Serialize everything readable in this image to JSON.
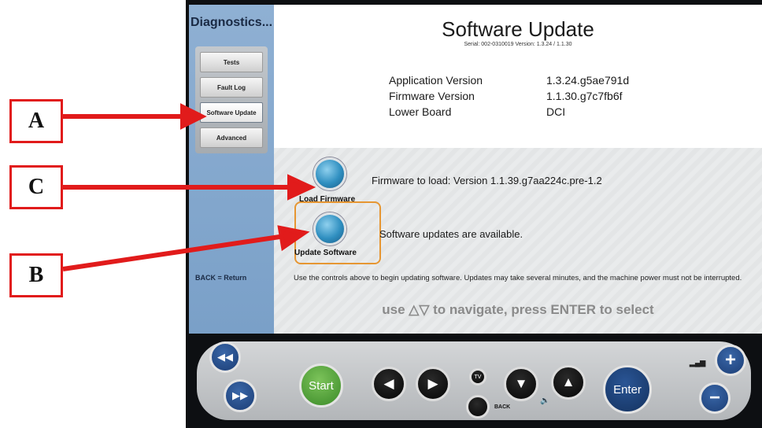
{
  "sidebar": {
    "title": "Diagnostics...",
    "items": [
      {
        "label": "Tests"
      },
      {
        "label": "Fault Log"
      },
      {
        "label": "Software Update"
      },
      {
        "label": "Advanced"
      }
    ],
    "back_hint": "BACK = Return"
  },
  "header": {
    "title": "Software Update",
    "serial_line": "Serial: 002-0310019  Version: 1.3.24 / 1.1.30"
  },
  "info": [
    {
      "label": "Application Version",
      "value": "1.3.24.g5ae791d"
    },
    {
      "label": "Firmware Version",
      "value": "1.1.30.g7c7fb6f"
    },
    {
      "label": "Lower Board",
      "value": "DCI"
    }
  ],
  "actions": {
    "load_firmware_label": "Load Firmware",
    "firmware_message": "Firmware to load: Version 1.1.39.g7aa224c.pre-1.2",
    "update_software_label": "Update Software",
    "software_message": "Software updates are available."
  },
  "note": "Use the controls above to begin updating software.  Updates may take several minutes, and the machine power must not be interrupted.",
  "nav_hint": "use △▽ to navigate, press ENTER to select",
  "controls": {
    "start_label": "Start",
    "enter_label": "Enter",
    "back_label": "BACK",
    "tv_label": "TV",
    "rewind_icon": "◀◀",
    "ffwd_icon": "▶▶",
    "left_icon": "◀",
    "right_icon": "▶",
    "down_icon": "▼",
    "up_icon": "▲",
    "plus_icon": "+",
    "minus_icon": "−",
    "sound_icon": "🔈",
    "volume_icon": "▂▄▆"
  },
  "callouts": {
    "a": "A",
    "b": "B",
    "c": "C"
  },
  "colors": {
    "callout_red": "#e11b1b",
    "selection_orange": "#e69632",
    "sidebar_blue": "#7aa0c8"
  }
}
